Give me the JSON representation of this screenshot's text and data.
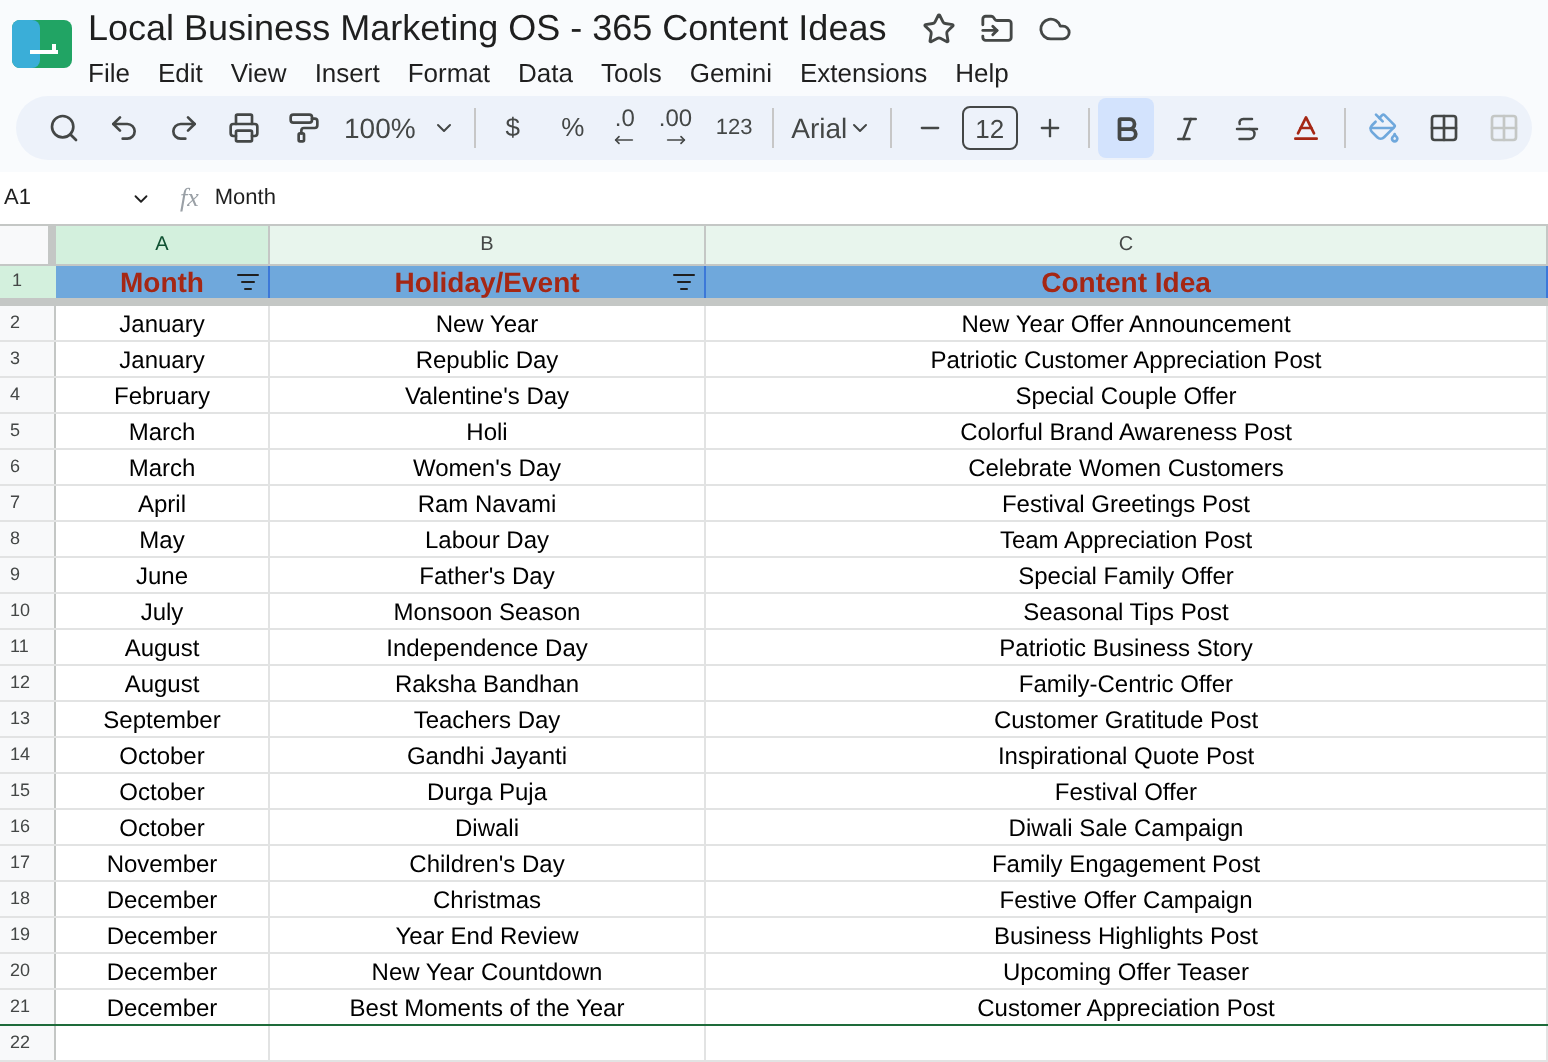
{
  "document": {
    "title": "Local Business Marketing OS - 365 Content Ideas"
  },
  "menu": [
    "File",
    "Edit",
    "View",
    "Insert",
    "Format",
    "Data",
    "Tools",
    "Gemini",
    "Extensions",
    "Help"
  ],
  "toolbar": {
    "zoom": "100%",
    "currency": "$",
    "percent": "%",
    "decrease_decimal": ".0",
    "increase_decimal": ".00",
    "number_format": "123",
    "font": "Arial",
    "font_size": "12",
    "bold": true,
    "italic": false,
    "strikethrough": false
  },
  "formula_bar": {
    "cell": "A1",
    "fx": "fx",
    "value": "Month"
  },
  "sheet": {
    "columns": [
      {
        "letter": "A",
        "selected": true
      },
      {
        "letter": "B",
        "selected": false
      },
      {
        "letter": "C",
        "selected": false
      }
    ],
    "header": {
      "row_number": "1",
      "cells": [
        "Month",
        "Holiday/Event",
        "Content Idea"
      ]
    },
    "rows": [
      {
        "n": "2",
        "cells": [
          "January",
          "New Year",
          "New Year Offer Announcement"
        ]
      },
      {
        "n": "3",
        "cells": [
          "January",
          "Republic Day",
          "Patriotic Customer Appreciation Post"
        ]
      },
      {
        "n": "4",
        "cells": [
          "February",
          "Valentine's Day",
          "Special Couple Offer"
        ]
      },
      {
        "n": "5",
        "cells": [
          "March",
          "Holi",
          "Colorful Brand Awareness Post"
        ]
      },
      {
        "n": "6",
        "cells": [
          "March",
          "Women's Day",
          "Celebrate Women Customers"
        ]
      },
      {
        "n": "7",
        "cells": [
          "April",
          "Ram Navami",
          "Festival Greetings Post"
        ]
      },
      {
        "n": "8",
        "cells": [
          "May",
          "Labour Day",
          "Team Appreciation Post"
        ]
      },
      {
        "n": "9",
        "cells": [
          "June",
          "Father's Day",
          "Special Family Offer"
        ]
      },
      {
        "n": "10",
        "cells": [
          "July",
          "Monsoon Season",
          "Seasonal Tips Post"
        ]
      },
      {
        "n": "11",
        "cells": [
          "August",
          "Independence Day",
          "Patriotic Business Story"
        ]
      },
      {
        "n": "12",
        "cells": [
          "August",
          "Raksha Bandhan",
          "Family-Centric Offer"
        ]
      },
      {
        "n": "13",
        "cells": [
          "September",
          "Teachers Day",
          "Customer Gratitude Post"
        ]
      },
      {
        "n": "14",
        "cells": [
          "October",
          "Gandhi Jayanti",
          "Inspirational Quote Post"
        ]
      },
      {
        "n": "15",
        "cells": [
          "October",
          "Durga Puja",
          "Festival Offer"
        ]
      },
      {
        "n": "16",
        "cells": [
          "October",
          "Diwali",
          "Diwali Sale Campaign"
        ]
      },
      {
        "n": "17",
        "cells": [
          "November",
          "Children's Day",
          "Family Engagement Post"
        ]
      },
      {
        "n": "18",
        "cells": [
          "December",
          "Christmas",
          "Festive Offer Campaign"
        ]
      },
      {
        "n": "19",
        "cells": [
          "December",
          "Year End Review",
          "Business Highlights Post"
        ]
      },
      {
        "n": "20",
        "cells": [
          "December",
          "New Year Countdown",
          "Upcoming Offer Teaser"
        ]
      },
      {
        "n": "21",
        "cells": [
          "December",
          "Best Moments of the Year",
          "Customer Appreciation Post"
        ]
      },
      {
        "n": "22",
        "cells": []
      }
    ]
  }
}
